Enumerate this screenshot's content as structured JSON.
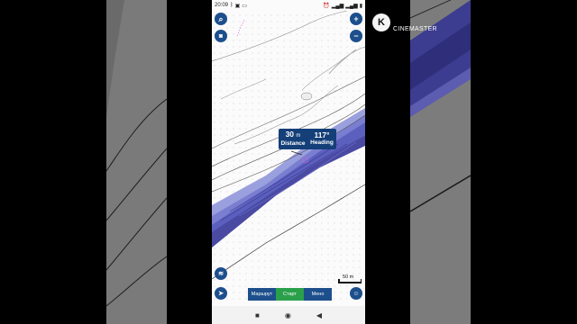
{
  "status_bar": {
    "time": "20:09",
    "left_icons": [
      "bluetooth-icon",
      "gallery-icon",
      "cast-icon"
    ],
    "right_icons": [
      "alarm-icon",
      "signal-icon",
      "signal-icon",
      "battery-icon"
    ]
  },
  "tooltip": {
    "distance_value": "30",
    "distance_unit": "m",
    "distance_label": "Distance",
    "heading_value": "117°",
    "heading_label": "Heading"
  },
  "controls": {
    "zoom_in": "+",
    "zoom_out": "−"
  },
  "tabs": [
    {
      "label": "Маршрут",
      "active": false
    },
    {
      "label": "Старт",
      "active": true
    },
    {
      "label": "Мено",
      "active": false
    }
  ],
  "scale_label": "50 m",
  "watermark": {
    "logo_letter": "K",
    "text": "CINEMASTER"
  },
  "colors": {
    "ui_blue": "#1d4f8c",
    "tooltip_blue": "#143f78",
    "start_green": "#2aa04a",
    "depth_dark": "#4a4aa3",
    "depth_light": "#8a8fd6"
  }
}
